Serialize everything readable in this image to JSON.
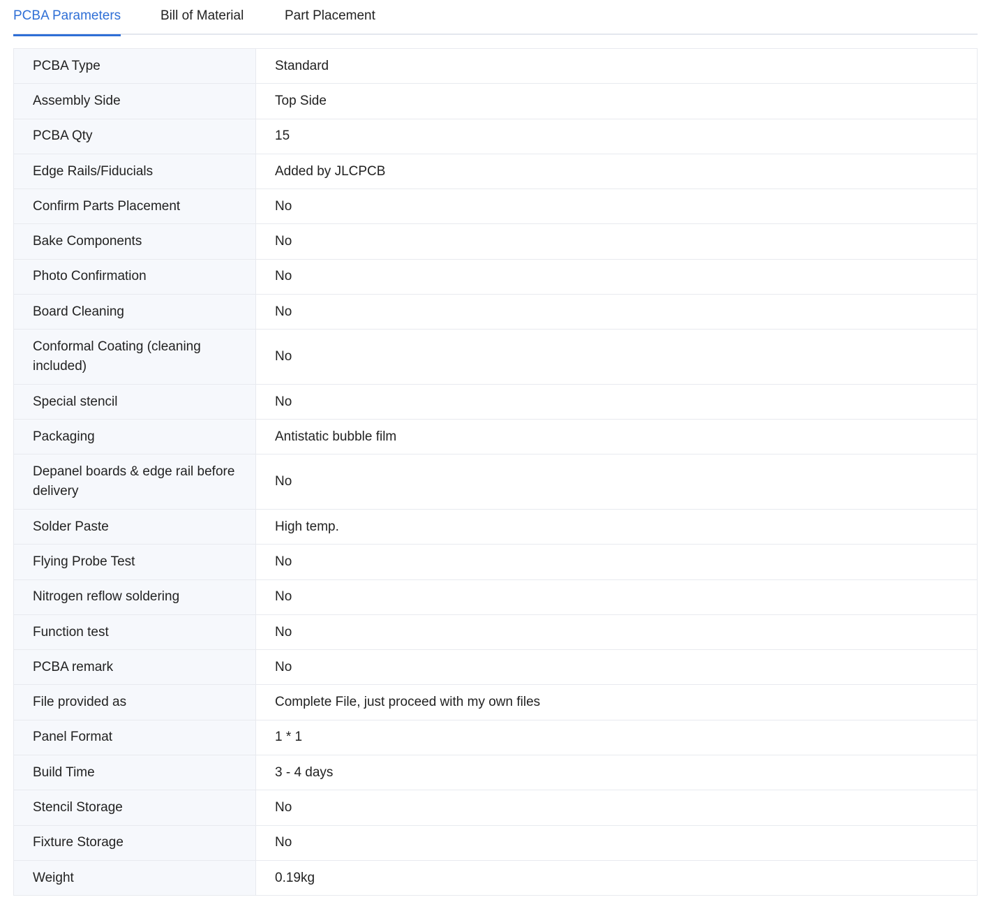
{
  "tabs": [
    {
      "label": "PCBA Parameters",
      "active": true
    },
    {
      "label": "Bill of Material",
      "active": false
    },
    {
      "label": "Part Placement",
      "active": false
    }
  ],
  "colors": {
    "accent": "#2f6fd6",
    "label_bg": "#f6f8fc",
    "border": "#e8eaef"
  },
  "parameters": [
    {
      "label": "PCBA Type",
      "value": "Standard"
    },
    {
      "label": "Assembly Side",
      "value": "Top Side"
    },
    {
      "label": "PCBA Qty",
      "value": "15"
    },
    {
      "label": "Edge Rails/Fiducials",
      "value": "Added by JLCPCB"
    },
    {
      "label": "Confirm Parts Placement",
      "value": "No"
    },
    {
      "label": "Bake Components",
      "value": "No"
    },
    {
      "label": "Photo Confirmation",
      "value": "No"
    },
    {
      "label": "Board Cleaning",
      "value": "No"
    },
    {
      "label": "Conformal Coating (cleaning included)",
      "value": "No"
    },
    {
      "label": "Special stencil",
      "value": "No"
    },
    {
      "label": "Packaging",
      "value": "Antistatic bubble film"
    },
    {
      "label": "Depanel boards & edge rail before delivery",
      "value": "No"
    },
    {
      "label": "Solder Paste",
      "value": "High temp."
    },
    {
      "label": "Flying Probe Test",
      "value": "No"
    },
    {
      "label": "Nitrogen reflow soldering",
      "value": "No"
    },
    {
      "label": "Function test",
      "value": "No"
    },
    {
      "label": "PCBA remark",
      "value": "No"
    },
    {
      "label": "File provided as",
      "value": "Complete File, just proceed with my own files"
    },
    {
      "label": "Panel Format",
      "value": "1 * 1"
    },
    {
      "label": "Build Time",
      "value": "3 - 4 days"
    },
    {
      "label": "Stencil Storage",
      "value": "No"
    },
    {
      "label": "Fixture Storage",
      "value": "No"
    },
    {
      "label": "Weight",
      "value": "0.19kg"
    }
  ]
}
